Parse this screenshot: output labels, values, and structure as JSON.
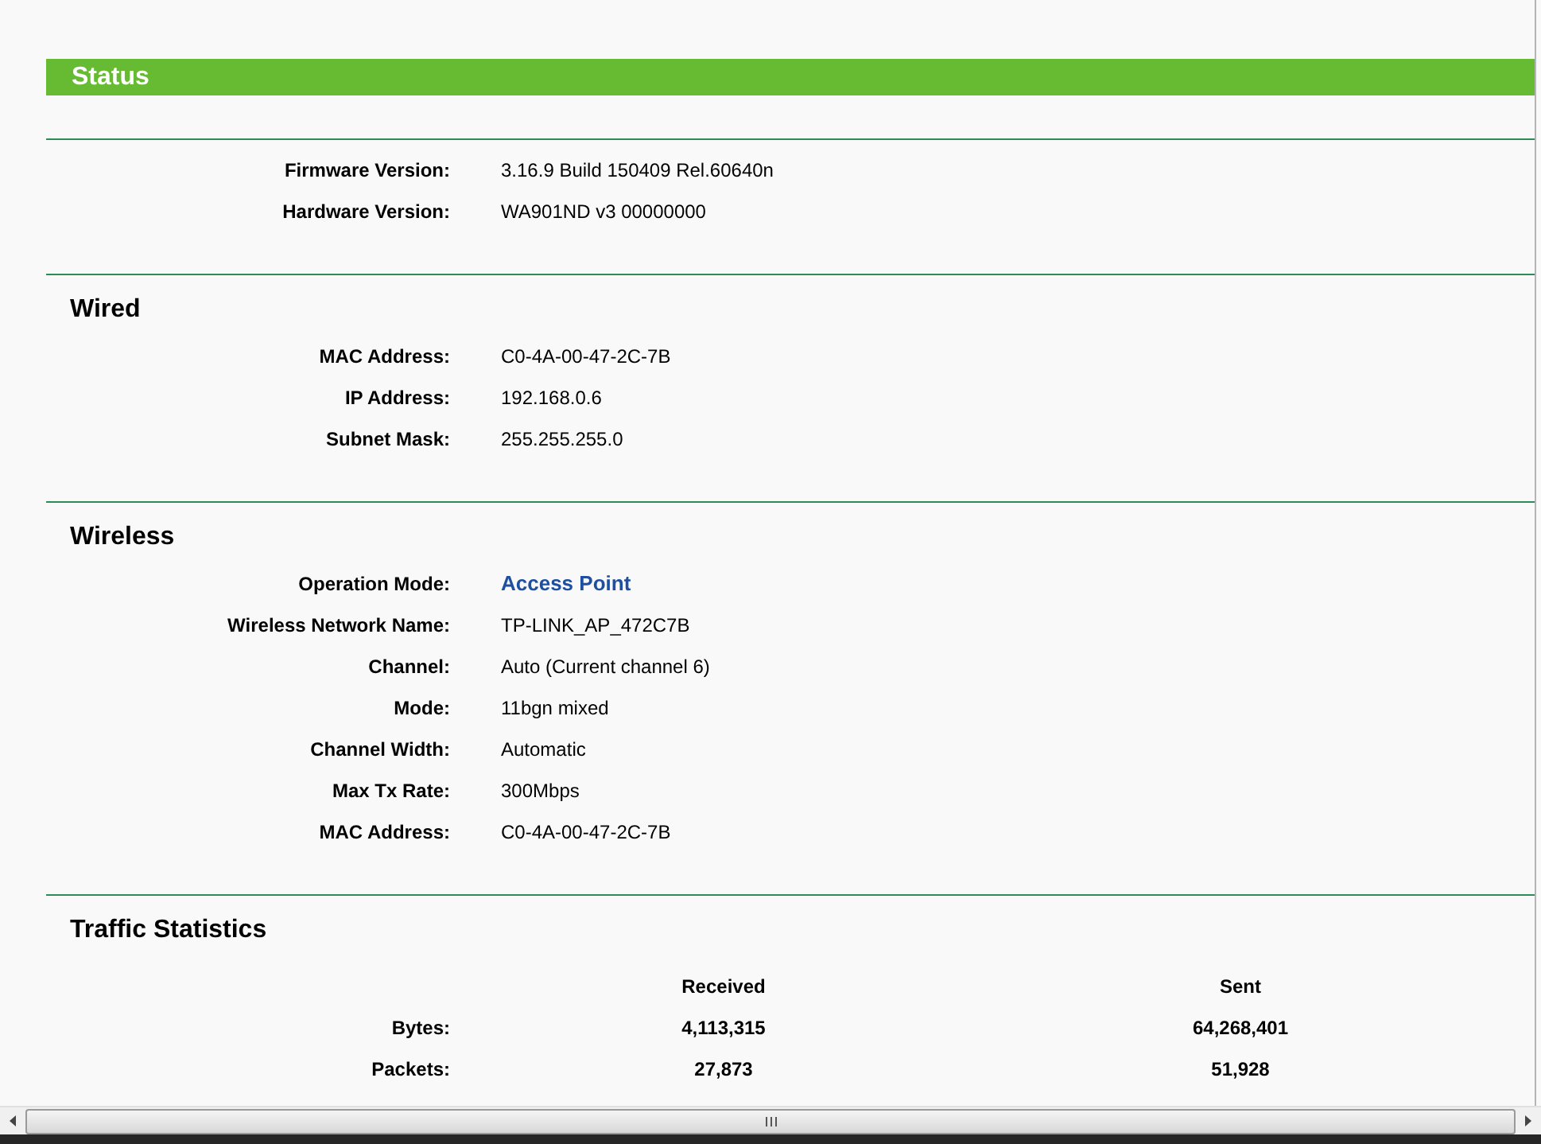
{
  "title": "Status",
  "sections": [
    {
      "kind": "info",
      "rows": [
        {
          "label": "Firmware Version:",
          "value": "3.16.9 Build 150409 Rel.60640n",
          "kind": "text"
        },
        {
          "label": "Hardware Version:",
          "value": "WA901ND v3 00000000",
          "kind": "text"
        }
      ]
    },
    {
      "kind": "info",
      "heading": "Wired",
      "rows": [
        {
          "label": "MAC Address:",
          "value": "C0-4A-00-47-2C-7B",
          "kind": "text"
        },
        {
          "label": "IP Address:",
          "value": "192.168.0.6",
          "kind": "text"
        },
        {
          "label": "Subnet Mask:",
          "value": "255.255.255.0",
          "kind": "text"
        }
      ]
    },
    {
      "kind": "info",
      "heading": "Wireless",
      "rows": [
        {
          "label": "Operation Mode:",
          "value": "Access Point",
          "kind": "highlight"
        },
        {
          "label": "Wireless Network Name:",
          "value": "TP-LINK_AP_472C7B",
          "kind": "text"
        },
        {
          "label": "Channel:",
          "value": "Auto (Current channel 6)",
          "kind": "text"
        },
        {
          "label": "Mode:",
          "value": "11bgn mixed",
          "kind": "text"
        },
        {
          "label": "Channel Width:",
          "value": "Automatic",
          "kind": "text"
        },
        {
          "label": "Max Tx Rate:",
          "value": "300Mbps",
          "kind": "text"
        },
        {
          "label": "MAC Address:",
          "value": "C0-4A-00-47-2C-7B",
          "kind": "text"
        }
      ]
    },
    {
      "kind": "traffic",
      "heading": "Traffic Statistics",
      "columns": [
        "Received",
        "Sent"
      ],
      "rows": [
        {
          "label": "Bytes:",
          "values": [
            "4,113,315",
            "64,268,401"
          ]
        },
        {
          "label": "Packets:",
          "values": [
            "27,873",
            "51,928"
          ]
        }
      ]
    }
  ]
}
